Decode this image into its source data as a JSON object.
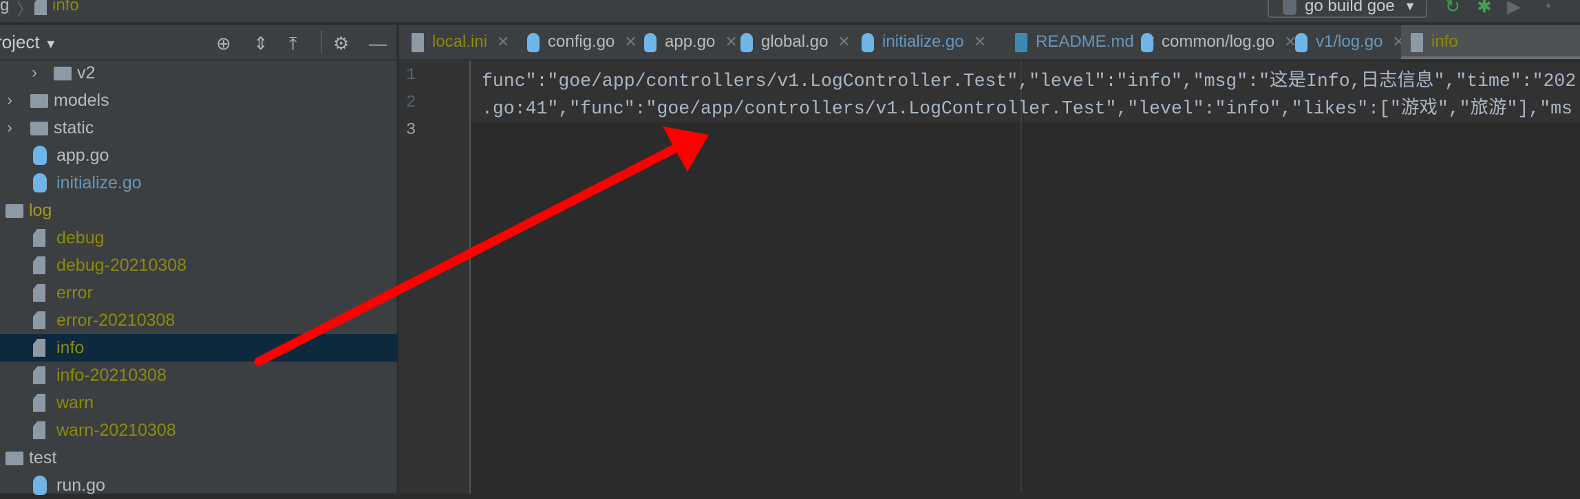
{
  "breadcrumb": {
    "prev": "g",
    "current": "info"
  },
  "run_config": {
    "label": "go build goe"
  },
  "sidebar": {
    "title": "roject",
    "tools": [
      "crosshair-icon",
      "expand-all-icon",
      "collapse-all-icon",
      "gear-icon",
      "minimize-icon"
    ],
    "items": [
      {
        "label": "v2",
        "type": "folder",
        "indent": 2,
        "color": "#bbbbbb"
      },
      {
        "label": "models",
        "type": "folder",
        "indent": 1,
        "color": "#bbbbbb"
      },
      {
        "label": "static",
        "type": "folder",
        "indent": 1,
        "color": "#bbbbbb"
      },
      {
        "label": "app.go",
        "type": "go",
        "indent": 2,
        "color": "#bbbbbb"
      },
      {
        "label": "initialize.go",
        "type": "go",
        "indent": 2,
        "color": "#6897bb"
      },
      {
        "label": "log",
        "type": "folder",
        "indent": 0,
        "color": "#a09a1e"
      },
      {
        "label": "debug",
        "type": "link",
        "indent": 2,
        "color": "#8c8a0a"
      },
      {
        "label": "debug-20210308",
        "type": "file",
        "indent": 2,
        "color": "#8c8a0a"
      },
      {
        "label": "error",
        "type": "link",
        "indent": 2,
        "color": "#8c8a0a"
      },
      {
        "label": "error-20210308",
        "type": "file",
        "indent": 2,
        "color": "#8c8a0a"
      },
      {
        "label": "info",
        "type": "link",
        "indent": 2,
        "color": "#8c8a0a",
        "selected": true
      },
      {
        "label": "info-20210308",
        "type": "file",
        "indent": 2,
        "color": "#8c8a0a"
      },
      {
        "label": "warn",
        "type": "link",
        "indent": 2,
        "color": "#8c8a0a"
      },
      {
        "label": "warn-20210308",
        "type": "file",
        "indent": 2,
        "color": "#8c8a0a"
      },
      {
        "label": "test",
        "type": "folder",
        "indent": 0,
        "color": "#bbbbbb"
      },
      {
        "label": "run.go",
        "type": "go",
        "indent": 2,
        "color": "#bbbbbb"
      }
    ]
  },
  "tabs": [
    {
      "label": "local.ini",
      "color": "#8c8a0a"
    },
    {
      "label": "config.go",
      "color": "#bbbbbb"
    },
    {
      "label": "app.go",
      "color": "#bbbbbb"
    },
    {
      "label": "global.go",
      "color": "#bbbbbb"
    },
    {
      "label": "initialize.go",
      "color": "#6897bb"
    },
    {
      "label": "README.md",
      "color": "#6897bb"
    },
    {
      "label": "common/log.go",
      "color": "#bbbbbb"
    },
    {
      "label": "v1/log.go",
      "color": "#6897bb"
    },
    {
      "label": "info",
      "color": "#8c8a0a",
      "active": true
    }
  ],
  "editor": {
    "line_numbers": [
      "1",
      "2",
      "3"
    ],
    "lines": [
      "func\":\"goe/app/controllers/v1.LogController.Test\",\"level\":\"info\",\"msg\":\"这是Info,日志信息\",\"time\":\"202",
      ".go:41\",\"func\":\"goe/app/controllers/v1.LogController.Test\",\"level\":\"info\",\"likes\":[\"游戏\",\"旅游\"],\"ms",
      ""
    ]
  },
  "annotation": {
    "type": "red-arrow",
    "color": "#ff0000"
  }
}
